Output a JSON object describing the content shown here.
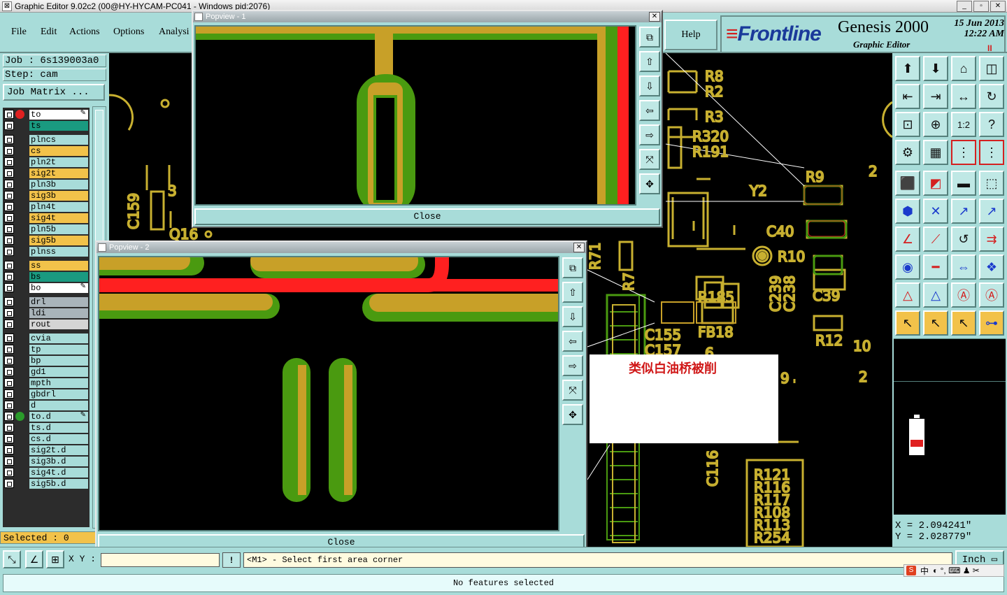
{
  "window": {
    "title": "Graphic Editor 9.02c2 (00@HY-HYCAM-PC041 - Windows pid:2076)",
    "controls": [
      "_",
      "▫",
      "✕"
    ]
  },
  "menu": {
    "file": "File",
    "edit": "Edit",
    "actions": "Actions",
    "options": "Options",
    "analysis": "Analysi",
    "help": "Help"
  },
  "brand": {
    "logo_prefix": "≡",
    "logo_f": "Fr",
    "logo_rest": "ontline",
    "product": "Genesis 2000",
    "subtitle": "Graphic Editor",
    "date": "15 Jun 2013",
    "time": "12:22 AM",
    "indicator": "II"
  },
  "job": {
    "job_label": "Job  : 6s139003a0",
    "step_label": "Step: cam",
    "matrix_button": "Job Matrix ..."
  },
  "layers": [
    {
      "name": "to",
      "color": "#ffffff",
      "dot": "#e02020",
      "editable": true
    },
    {
      "name": "ts",
      "color": "#1a9a80",
      "dot": "",
      "editable": false
    },
    {
      "name": "plncs",
      "color": "#a8dcd9",
      "dot": "",
      "editable": false
    },
    {
      "name": "cs",
      "color": "#f2c24a",
      "dot": "",
      "editable": false
    },
    {
      "name": "pln2t",
      "color": "#a8dcd9",
      "dot": "",
      "editable": false
    },
    {
      "name": "sig2t",
      "color": "#f2c24a",
      "dot": "",
      "editable": false
    },
    {
      "name": "pln3b",
      "color": "#a8dcd9",
      "dot": "",
      "editable": false
    },
    {
      "name": "sig3b",
      "color": "#f2c24a",
      "dot": "",
      "editable": false
    },
    {
      "name": "pln4t",
      "color": "#a8dcd9",
      "dot": "",
      "editable": false
    },
    {
      "name": "sig4t",
      "color": "#f2c24a",
      "dot": "",
      "editable": false
    },
    {
      "name": "pln5b",
      "color": "#a8dcd9",
      "dot": "",
      "editable": false
    },
    {
      "name": "sig5b",
      "color": "#f2c24a",
      "dot": "",
      "editable": false
    },
    {
      "name": "plnss",
      "color": "#a8dcd9",
      "dot": "",
      "editable": false
    },
    {
      "name": "ss",
      "color": "#f2c24a",
      "dot": "",
      "editable": false
    },
    {
      "name": "bs",
      "color": "#1a9a80",
      "dot": "",
      "editable": false
    },
    {
      "name": "bo",
      "color": "#ffffff",
      "dot": "",
      "editable": true
    },
    {
      "name": "drl",
      "color": "#a9b4ba",
      "dot": "",
      "editable": false
    },
    {
      "name": "ldi",
      "color": "#a9b4ba",
      "dot": "",
      "editable": false
    },
    {
      "name": "rout",
      "color": "#d4d4d4",
      "dot": "",
      "editable": false
    },
    {
      "name": "cvia",
      "color": "#a8dcd9",
      "dot": "",
      "editable": false
    },
    {
      "name": "tp",
      "color": "#a8dcd9",
      "dot": "",
      "editable": false
    },
    {
      "name": "bp",
      "color": "#a8dcd9",
      "dot": "",
      "editable": false
    },
    {
      "name": "gd1",
      "color": "#a8dcd9",
      "dot": "",
      "editable": false
    },
    {
      "name": "mpth",
      "color": "#a8dcd9",
      "dot": "",
      "editable": false
    },
    {
      "name": "gbdrl",
      "color": "#a8dcd9",
      "dot": "",
      "editable": false
    },
    {
      "name": "d",
      "color": "#a8dcd9",
      "dot": "",
      "editable": false
    },
    {
      "name": "to.d",
      "color": "#a8dcd9",
      "dot": "#2a9a2a",
      "editable": true
    },
    {
      "name": "ts.d",
      "color": "#a8dcd9",
      "dot": "",
      "editable": false
    },
    {
      "name": "cs.d",
      "color": "#a8dcd9",
      "dot": "",
      "editable": false
    },
    {
      "name": "sig2t.d",
      "color": "#a8dcd9",
      "dot": "",
      "editable": false
    },
    {
      "name": "sig3b.d",
      "color": "#a8dcd9",
      "dot": "",
      "editable": false
    },
    {
      "name": "sig4t.d",
      "color": "#a8dcd9",
      "dot": "",
      "editable": false
    },
    {
      "name": "sig5b.d",
      "color": "#a8dcd9",
      "dot": "",
      "editable": false
    }
  ],
  "selected": "Selected : 0",
  "canvas_labels": {
    "r8": "R8",
    "r2": "R2",
    "r3": "R3",
    "r320": "R320",
    "r191": "R191",
    "r9": "R9",
    "y2": "Y2",
    "c40": "C40",
    "r10": "R10",
    "c39": "C39",
    "c239": "C239",
    "c238": "C238",
    "r185": "R185",
    "fb18": "FB18",
    "c155": "C155",
    "c157": "C157",
    "r12": "R12",
    "n10": "10",
    "n2a": "2",
    "n2b": "2",
    "c159": "C159",
    "q16": "Q16",
    "n3": "3",
    "r7": "R7",
    "r71": "R71",
    "c116": "C116",
    "n9": "9",
    "n6": "6",
    "r121": "R121",
    "r116": "R116",
    "r117": "R117",
    "r108": "R108",
    "r113": "R113",
    "r254": "R254"
  },
  "popup1": {
    "title": "Popview - 1",
    "close": "Close"
  },
  "popup2": {
    "title": "Popview - 2",
    "close": "Close"
  },
  "note": "类似白油桥被削",
  "coords": {
    "x": "X = 2.094241\"",
    "y": "Y = 2.028779\""
  },
  "bottom": {
    "xy_label": "X Y :",
    "xy_value": "",
    "excl": "!",
    "prompt": "<M1> - Select first area corner",
    "units": "Inch"
  },
  "status": "No features selected",
  "ime": {
    "s": "S",
    "zh": "中",
    "symbols": "◐ °, ⌨ ♟ ✂"
  },
  "colors": {
    "panel": "#a8dcd9",
    "copper_green": "#4a9a10",
    "copper_olive": "#c8a028",
    "trace_red": "#ff2020",
    "silk_yellow": "#c8b030"
  }
}
